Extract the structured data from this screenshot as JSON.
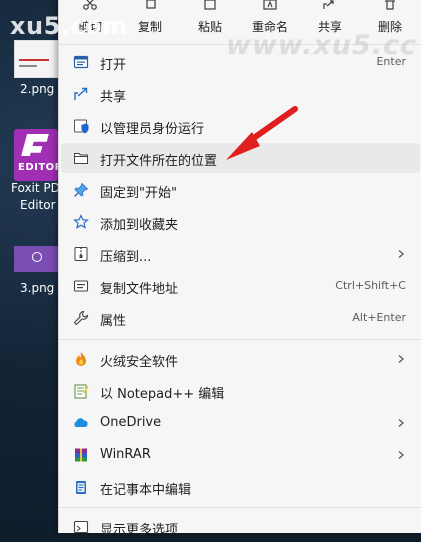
{
  "watermark": {
    "left": "xu5.com",
    "right": "www.xu5.cc"
  },
  "desktop": {
    "icons": [
      {
        "label": "2.png"
      },
      {
        "label_line1": "Foxit PD",
        "label_line2": "Editor",
        "badge": "EDITOR"
      },
      {
        "label": "3.png"
      }
    ]
  },
  "toolbar": {
    "items": [
      {
        "label": "剪切",
        "icon": "scissors-icon"
      },
      {
        "label": "复制",
        "icon": "copy-icon"
      },
      {
        "label": "粘贴",
        "icon": "paste-icon"
      },
      {
        "label": "重命名",
        "icon": "rename-icon"
      },
      {
        "label": "共享",
        "icon": "share-icon"
      },
      {
        "label": "删除",
        "icon": "delete-icon"
      }
    ]
  },
  "menu": {
    "items": [
      {
        "label": "打开",
        "shortcut": "Enter",
        "icon": "open-app-icon"
      },
      {
        "label": "共享",
        "icon": "share-icon"
      },
      {
        "label": "以管理员身份运行",
        "icon": "admin-shield-icon"
      },
      {
        "label": "打开文件所在的位置",
        "icon": "folder-icon"
      },
      {
        "label": "固定到\"开始\"",
        "icon": "pin-icon"
      },
      {
        "label": "添加到收藏夹",
        "icon": "star-icon"
      },
      {
        "label": "压缩到...",
        "icon": "zip-icon",
        "submenu": true
      },
      {
        "label": "复制文件地址",
        "shortcut": "Ctrl+Shift+C",
        "icon": "copy-path-icon"
      },
      {
        "label": "属性",
        "shortcut": "Alt+Enter",
        "icon": "wrench-icon"
      },
      {
        "label": "火绒安全软件",
        "icon": "huorong-icon",
        "submenu": true
      },
      {
        "label": "以 Notepad++ 编辑",
        "icon": "notepadpp-icon"
      },
      {
        "label": "OneDrive",
        "icon": "onedrive-icon",
        "submenu": true
      },
      {
        "label": "WinRAR",
        "icon": "winrar-icon",
        "submenu": true
      },
      {
        "label": "在记事本中编辑",
        "icon": "notepad-icon"
      },
      {
        "label": "显示更多选项",
        "icon": "more-options-icon"
      }
    ]
  },
  "colors": {
    "accent": "#0067c0",
    "annotation_arrow": "#e02020"
  }
}
